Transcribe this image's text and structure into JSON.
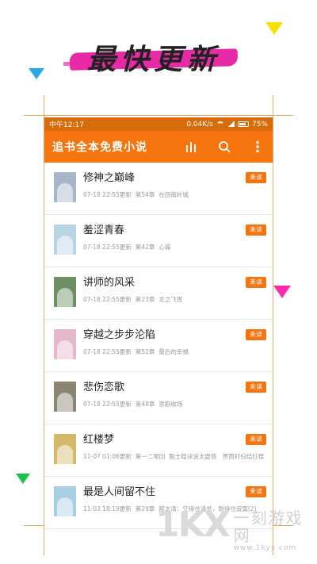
{
  "promo": {
    "headline": "最快更新"
  },
  "status_bar": {
    "time": "中午12:17",
    "speed": "0.04K/s",
    "battery": "75%"
  },
  "app_bar": {
    "title": "追书全本免费小说",
    "icons": [
      "ranking-bars-icon",
      "search-icon",
      "more-vert-icon"
    ]
  },
  "books": [
    {
      "title": "修神之巅峰",
      "time": "07-18 22:55更新",
      "chapter": "第54章",
      "latest": "在回南岭城",
      "badge": "未读",
      "cover_color": "#a8b6c9"
    },
    {
      "title": "羞涩青春",
      "time": "07-18 22:55更新",
      "chapter": "第42章",
      "latest": "心痛",
      "badge": "未读",
      "cover_color": "#b9d4e4"
    },
    {
      "title": "讲师的风采",
      "time": "07-18 22:55更新",
      "chapter": "第23章",
      "latest": "龙之飞宵",
      "badge": "未读",
      "cover_color": "#6e8f62"
    },
    {
      "title": "穿越之步步沦陷",
      "time": "07-18 22:55更新",
      "chapter": "第52章",
      "latest": "最后的幸福",
      "badge": "未读",
      "cover_color": "#e3b7cc"
    },
    {
      "title": "悲伤恋歌",
      "time": "07-18 22:55更新",
      "chapter": "第48章",
      "latest": "悲剧收场",
      "badge": "未读",
      "cover_color": "#8a8471"
    },
    {
      "title": "红楼梦",
      "time": "11-07 01:06更新",
      "chapter": "第一二零回",
      "latest": "甄士隐详说太虚情　贾雨村归结红楼梦",
      "badge": "未读",
      "cover_color": "#d6b86a"
    },
    {
      "title": "最是人间留不住",
      "time": "11-03 18:19更新",
      "chapter": "第29章",
      "latest": "颜太清：守得住清贫，耐得住寂寞(2)",
      "badge": "未读",
      "cover_color": "#a7cfe2"
    }
  ],
  "watermark": {
    "logo": "1KX",
    "name": "一刻游戏网",
    "url": "www.1kyx.com"
  },
  "colors": {
    "accent": "#f5740e",
    "status_bar": "#d86c0b"
  }
}
